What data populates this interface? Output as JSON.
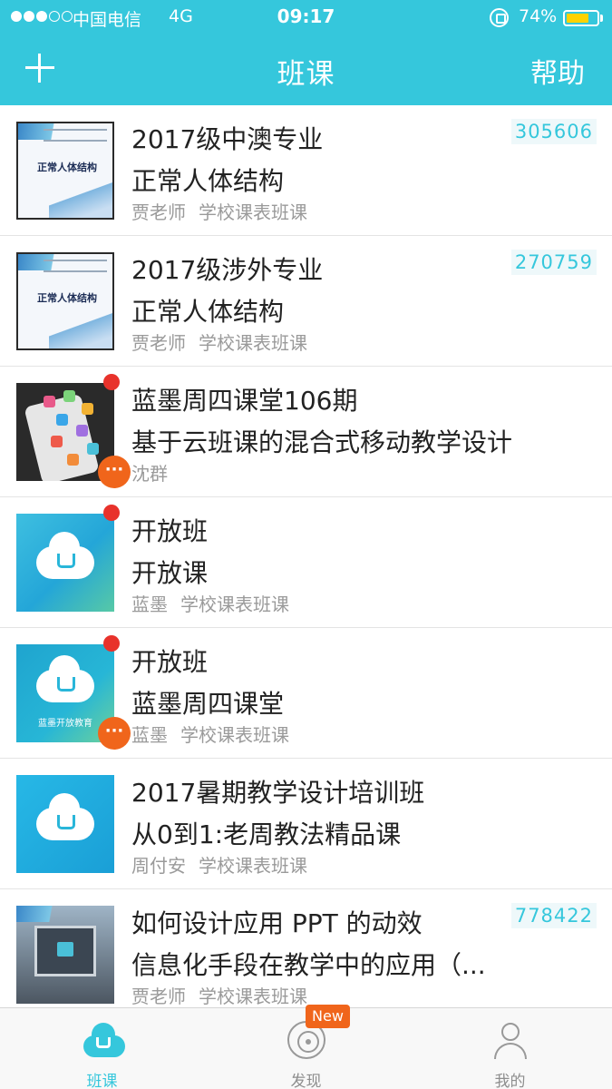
{
  "status_bar": {
    "carrier": "中国电信",
    "network": "4G",
    "time": "09:17",
    "battery_percent": "74%",
    "battery_level": 0.74,
    "signal_bars_filled": 3,
    "signal_bars_total": 5
  },
  "nav": {
    "add_icon": "plus-icon",
    "title": "班课",
    "help_label": "帮助"
  },
  "classes": [
    {
      "title": "2017级中澳专业",
      "subtitle": "正常人体结构",
      "teacher": "贾老师",
      "source": "学校课表班课",
      "code": "305606",
      "thumb": "book-cover",
      "book_title": "正常人体结构",
      "unread": false,
      "more": false
    },
    {
      "title": "2017级涉外专业",
      "subtitle": "正常人体结构",
      "teacher": "贾老师",
      "source": "学校课表班课",
      "code": "270759",
      "thumb": "book-cover",
      "book_title": "正常人体结构",
      "unread": false,
      "more": false
    },
    {
      "title": "蓝墨周四课堂106期",
      "subtitle": "基于云班课的混合式移动教学设计",
      "teacher": "沈群",
      "source": "",
      "code": "",
      "thumb": "phone-apps",
      "unread": true,
      "more": true
    },
    {
      "title": "开放班",
      "subtitle": "开放课",
      "teacher": "蓝墨",
      "source": "学校课表班课",
      "code": "",
      "thumb": "cloud",
      "unread": true,
      "more": false
    },
    {
      "title": "开放班",
      "subtitle": "蓝墨周四课堂",
      "teacher": "蓝墨",
      "source": "学校课表班课",
      "code": "",
      "thumb": "cloud-caption",
      "caption": "蓝墨开放教育",
      "unread": true,
      "more": true
    },
    {
      "title": "2017暑期教学设计培训班",
      "subtitle": "从0到1:老周教法精品课",
      "teacher": "周付安",
      "source": "学校课表班课",
      "code": "",
      "thumb": "cloud-plain",
      "unread": false,
      "more": false
    },
    {
      "title": "如何设计应用 PPT 的动效",
      "subtitle": "信息化手段在教学中的应用（...",
      "teacher": "贾老师",
      "source": "学校课表班课",
      "code": "778422",
      "thumb": "ppt",
      "unread": false,
      "more": false
    }
  ],
  "more_badge_text": "···",
  "tabbar": {
    "tabs": [
      {
        "label": "班课",
        "icon": "cloud-icon",
        "active": true
      },
      {
        "label": "发现",
        "icon": "disc-icon",
        "active": false,
        "badge": "New"
      },
      {
        "label": "我的",
        "icon": "user-icon",
        "active": false
      }
    ]
  },
  "colors": {
    "accent": "#35c7dc",
    "badge_orange": "#f0651b",
    "unread_red": "#e8322b",
    "meta_gray": "#9a9a9a"
  }
}
